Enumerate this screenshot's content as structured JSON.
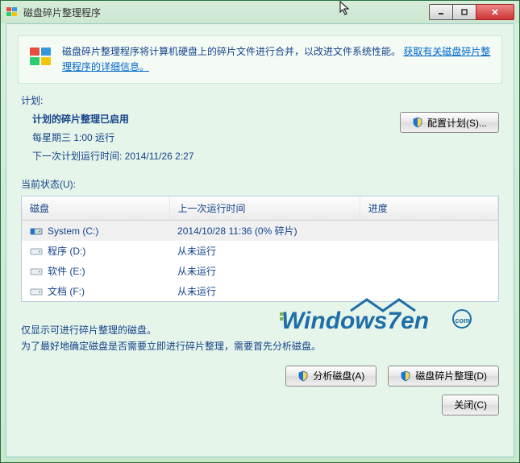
{
  "window": {
    "title": "磁盘碎片整理程序"
  },
  "banner": {
    "text_before": "磁盘碎片整理程序将计算机硬盘上的碎片文件进行合并，以改进文件系统性能。",
    "link": "获取有关磁盘碎片整理程序的详细信息。"
  },
  "labels": {
    "schedule": "计划:",
    "status": "当前状态(U):"
  },
  "schedule": {
    "enabled": "计划的碎片整理已启用",
    "freq": "每星期三  1:00 运行",
    "next": "下一次计划运行时间: 2014/11/26 2:27"
  },
  "buttons": {
    "configure": "配置计划(S)...",
    "analyze": "分析磁盘(A)",
    "defrag": "磁盘碎片整理(D)",
    "close": "关闭(C)"
  },
  "columns": {
    "disk": "磁盘",
    "lastrun": "上一次运行时间",
    "progress": "进度"
  },
  "disks": [
    {
      "name": "System (C:)",
      "lastrun": "2014/10/28 11:36 (0% 碎片)",
      "progress": "",
      "selected": true,
      "system": true
    },
    {
      "name": "程序 (D:)",
      "lastrun": "从未运行",
      "progress": "",
      "selected": false,
      "system": false
    },
    {
      "name": "软件 (E:)",
      "lastrun": "从未运行",
      "progress": "",
      "selected": false,
      "system": false
    },
    {
      "name": "文档 (F:)",
      "lastrun": "从未运行",
      "progress": "",
      "selected": false,
      "system": false
    }
  ],
  "note": {
    "line1": "仅显示可进行碎片整理的磁盘。",
    "line2": "为了最好地确定磁盘是否需要立即进行碎片整理，需要首先分析磁盘。"
  },
  "watermark": {
    "text1": "Windows7en",
    "text2": ".com"
  }
}
